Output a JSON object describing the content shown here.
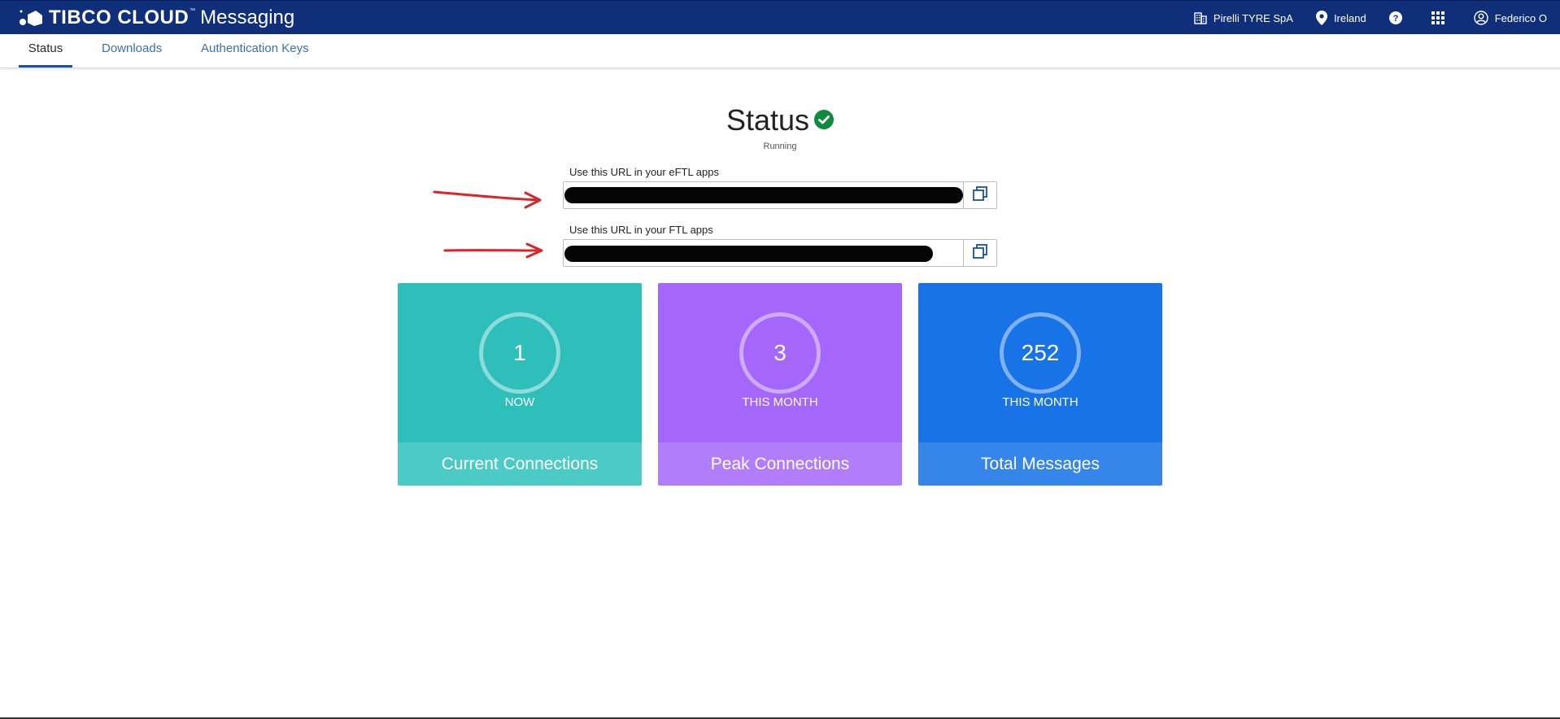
{
  "header": {
    "brand_name": "TIBCO CLOUD",
    "brand_tm": "™",
    "product": "Messaging",
    "org": "Pirelli TYRE SpA",
    "region": "Ireland",
    "help_icon": "help-icon",
    "apps_icon": "apps-grid-icon",
    "user": "Federico O"
  },
  "tabs": [
    {
      "label": "Status",
      "active": true
    },
    {
      "label": "Downloads",
      "active": false
    },
    {
      "label": "Authentication Keys",
      "active": false
    }
  ],
  "status": {
    "title": "Status",
    "state": "Running",
    "state_color": "#0e8a3e"
  },
  "urls": {
    "eftl_label": "Use this URL in your eFTL apps",
    "eftl_value": "",
    "ftl_label": "Use this URL in your FTL apps",
    "ftl_value": ""
  },
  "cards": [
    {
      "value": "1",
      "caption": "NOW",
      "title": "Current Connections",
      "color": "#2fbfbb"
    },
    {
      "value": "3",
      "caption": "THIS MONTH",
      "title": "Peak Connections",
      "color": "#a466fb"
    },
    {
      "value": "252",
      "caption": "THIS MONTH",
      "title": "Total Messages",
      "color": "#1873e6"
    }
  ],
  "annotation_color": "#d9262b"
}
